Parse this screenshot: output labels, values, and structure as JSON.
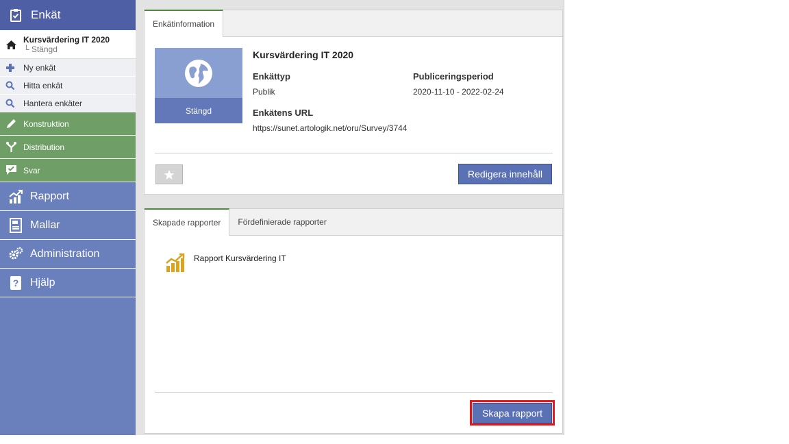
{
  "sidebar": {
    "enkat_label": "Enkät",
    "current_survey": {
      "title": "Kursvärdering IT 2020",
      "status": "└ Stängd"
    },
    "sub_items": [
      {
        "label": "Ny enkät",
        "icon": "plus-icon"
      },
      {
        "label": "Hitta enkät",
        "icon": "search-icon"
      },
      {
        "label": "Hantera enkäter",
        "icon": "search-icon"
      }
    ],
    "green_items": [
      {
        "label": "Konstruktion",
        "icon": "pencil-icon"
      },
      {
        "label": "Distribution",
        "icon": "distribution-icon"
      },
      {
        "label": "Svar",
        "icon": "check-chat-icon"
      }
    ],
    "main_items": [
      {
        "label": "Rapport",
        "icon": "chart-icon"
      },
      {
        "label": "Mallar",
        "icon": "template-icon"
      },
      {
        "label": "Administration",
        "icon": "gears-icon"
      },
      {
        "label": "Hjälp",
        "icon": "help-icon"
      }
    ]
  },
  "info_panel": {
    "tab_label": "Enkätinformation",
    "thumbnail_status": "Stängd",
    "survey_title": "Kursvärdering IT 2020",
    "type_label": "Enkättyp",
    "type_value": "Publik",
    "period_label": "Publiceringsperiod",
    "period_value": "2020-11-10 - 2022-02-24",
    "url_label": "Enkätens URL",
    "url_value": "https://sunet.artologik.net/oru/Survey/3744",
    "edit_button": "Redigera innehåll"
  },
  "reports_panel": {
    "tabs": [
      "Skapade rapporter",
      "Fördefinierade rapporter"
    ],
    "reports": [
      {
        "label": "Rapport Kursvärdering IT"
      }
    ],
    "create_button": "Skapa rapport"
  },
  "colors": {
    "sidebar_blue": "#6a80bd",
    "sidebar_dark": "#4e5fa5",
    "sidebar_green": "#6f9e66",
    "button_blue": "#5b71b5",
    "highlight_red": "#e3161c",
    "report_icon": "#d9a520"
  }
}
